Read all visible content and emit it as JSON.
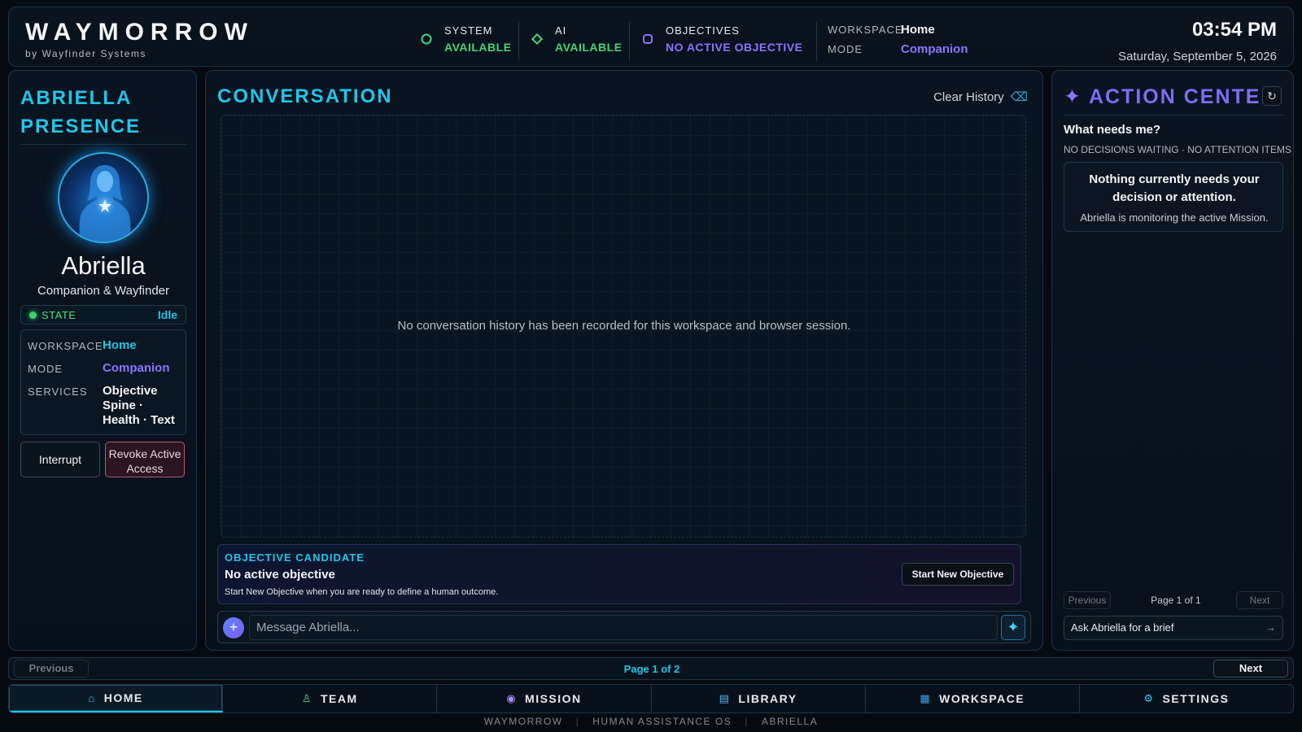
{
  "brand": {
    "name": "WAYMORROW",
    "sub": "by Wayfinder Systems"
  },
  "status": {
    "system": {
      "label": "SYSTEM",
      "value": "AVAILABLE",
      "color": "#45d27a"
    },
    "ai": {
      "label": "AI",
      "value": "AVAILABLE",
      "color": "#45d27a"
    },
    "objectives": {
      "label": "OBJECTIVES",
      "value": "NO ACTIVE OBJECTIVE",
      "color": "#8a74ff"
    }
  },
  "workspace_bar": {
    "workspace_label": "WORKSPACE",
    "workspace_value": "Home",
    "mode_label": "MODE",
    "mode_value": "Companion"
  },
  "clock": {
    "time": "03:54 PM",
    "date": "Saturday, September 5, 2026"
  },
  "presence": {
    "title": "ABRIELLA PRESENCE",
    "name": "Abriella",
    "role": "Companion & Wayfinder",
    "state_label": "STATE",
    "state_value": "Idle",
    "workspace_label": "WORKSPACE",
    "workspace_value": "Home",
    "mode_label": "MODE",
    "mode_value": "Companion",
    "services_label": "SERVICES",
    "services_value": "Objective Spine · Health · Text",
    "interrupt_label": "Interrupt",
    "revoke_label": "Revoke Active Access"
  },
  "conversation": {
    "title": "CONVERSATION",
    "clear_label": "Clear History",
    "empty_text": "No conversation history has been recorded for this workspace and browser session.",
    "objective": {
      "caption": "OBJECTIVE CANDIDATE",
      "title": "No active objective",
      "desc": "Start New Objective when you are ready to define a human outcome.",
      "button": "Start New Objective"
    },
    "input_placeholder": "Message Abriella..."
  },
  "action_center": {
    "title": "ACTION CENTER",
    "question": "What needs me?",
    "summary": "NO DECISIONS WAITING · NO ATTENTION ITEMS",
    "empty_main": "Nothing currently needs your decision or attention.",
    "empty_note": "Abriella is monitoring the active Mission.",
    "prev": "Previous",
    "page": "Page 1 of 1",
    "next": "Next",
    "brief": "Ask Abriella for a brief"
  },
  "pager": {
    "prev": "Previous",
    "label": "Page 1 of 2",
    "next": "Next"
  },
  "nav": [
    {
      "label": "HOME",
      "icon": "home-icon"
    },
    {
      "label": "TEAM",
      "icon": "person-icon"
    },
    {
      "label": "MISSION",
      "icon": "target-icon"
    },
    {
      "label": "LIBRARY",
      "icon": "book-icon"
    },
    {
      "label": "WORKSPACE",
      "icon": "grid-icon"
    },
    {
      "label": "SETTINGS",
      "icon": "gear-icon"
    }
  ],
  "footer": {
    "a": "WAYMORROW",
    "b": "HUMAN ASSISTANCE OS",
    "c": "ABRIELLA"
  }
}
